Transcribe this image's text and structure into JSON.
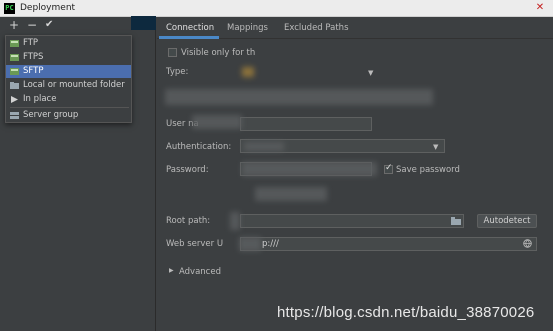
{
  "window": {
    "title": "Deployment",
    "close_glyph": "✕"
  },
  "toolbar": {
    "add_glyph": "+",
    "remove_glyph": "−",
    "apply_glyph": "✔"
  },
  "add_menu": {
    "items": [
      {
        "label": "FTP",
        "icon": "ftp-icon"
      },
      {
        "label": "FTPS",
        "icon": "ftps-icon"
      },
      {
        "label": "SFTP",
        "icon": "sftp-icon",
        "selected": true
      },
      {
        "label": "Local or mounted folder",
        "icon": "folder-icon"
      },
      {
        "label": "In place",
        "icon": "in-place-icon"
      },
      {
        "label": "Server group",
        "icon": "server-group-icon"
      }
    ]
  },
  "tabs": [
    {
      "label": "Connection",
      "active": true
    },
    {
      "label": "Mappings"
    },
    {
      "label": "Excluded Paths"
    }
  ],
  "connection": {
    "visible_only_label": "Visible only for th",
    "type_label": "Type:",
    "user_name_label": "User na",
    "authentication_label": "Authentication:",
    "password_label": "Password:",
    "save_password_label": "Save password",
    "root_path_label": "Root path:",
    "autodetect_label": "Autodetect",
    "web_server_label": "Web server U",
    "web_server_value": "p:///",
    "advanced_label": "Advanced"
  },
  "watermark": "https://blog.csdn.net/baidu_38870026",
  "colors": {
    "accent": "#4a88c7",
    "selection": "#4b6eaf",
    "background": "#3c3f41"
  }
}
